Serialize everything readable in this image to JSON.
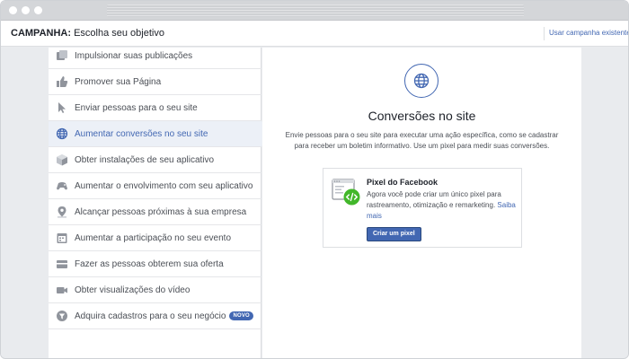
{
  "header": {
    "title_bold": "CAMPANHA:",
    "title_rest": " Escolha seu objetivo",
    "existing_campaign_link": "Usar campanha existente"
  },
  "objectives": [
    {
      "label": "Impulsionar suas publicações",
      "icon": "posts-icon"
    },
    {
      "label": "Promover sua Página",
      "icon": "thumbs-up-icon"
    },
    {
      "label": "Enviar pessoas para o seu site",
      "icon": "cursor-icon"
    },
    {
      "label": "Aumentar conversões no seu site",
      "icon": "globe-icon",
      "selected": true
    },
    {
      "label": "Obter instalações de seu aplicativo",
      "icon": "box-icon"
    },
    {
      "label": "Aumentar o envolvimento com seu aplicativo",
      "icon": "gamepad-icon"
    },
    {
      "label": "Alcançar pessoas próximas à sua empresa",
      "icon": "location-pin-icon"
    },
    {
      "label": "Aumentar a participação no seu evento",
      "icon": "calendar-icon"
    },
    {
      "label": "Fazer as pessoas obterem sua oferta",
      "icon": "offer-icon"
    },
    {
      "label": "Obter visualizações do vídeo",
      "icon": "video-camera-icon"
    },
    {
      "label": "Adquira cadastros para o seu negócio",
      "icon": "funnel-icon",
      "badge": "NOVO"
    }
  ],
  "detail": {
    "title": "Conversões no site",
    "description": "Envie pessoas para o seu site para executar uma ação específica, como se cadastrar para receber um boletim informativo. Use um pixel para medir suas conversões.",
    "pixel_card": {
      "title": "Pixel do Facebook",
      "description": "Agora você pode criar um único pixel para rastreamento, otimização e remarketing. ",
      "learn_more": "Saiba mais",
      "button": "Criar um pixel"
    }
  },
  "colors": {
    "accent": "#4267b2",
    "selected_bg": "#ecf0f7",
    "text": "#4b4f56",
    "code_badge": "#42b72a"
  }
}
